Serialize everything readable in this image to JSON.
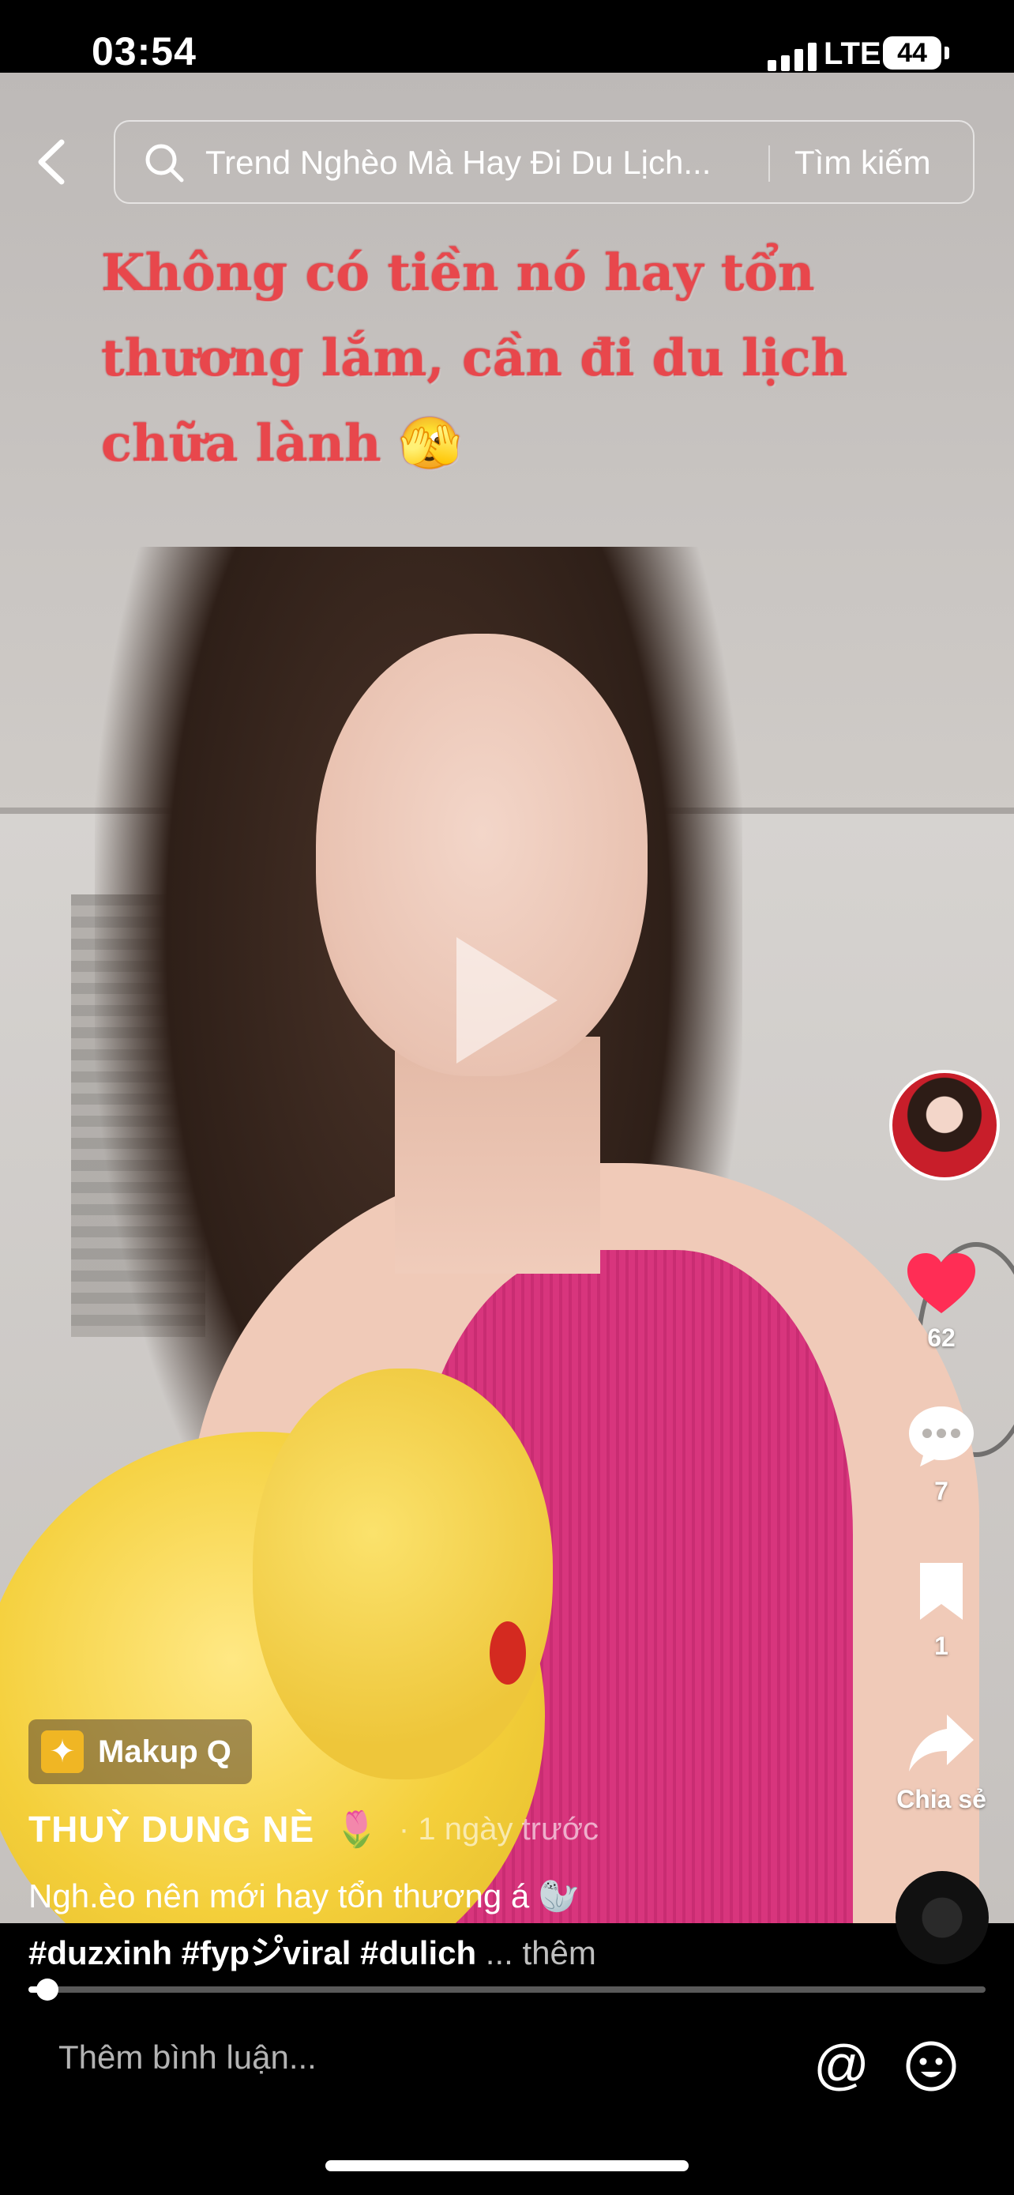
{
  "status_bar": {
    "time": "03:54",
    "network": "LTE",
    "battery": "44"
  },
  "search": {
    "query": "Trend Nghèo Mà Hay Đi Du Lịch...",
    "button_label": "Tìm kiếm"
  },
  "video": {
    "overlay_text": "Không có tiền nó hay tổn thương lắm, cần đi du lịch chữa lành 🫣"
  },
  "rail": {
    "likes": "62",
    "comments": "7",
    "bookmarks": "1",
    "share_label": "Chia sẻ"
  },
  "post": {
    "effect_label": "Makup Q",
    "author": "THUỲ DUNG NÈ",
    "author_emoji": "🌷",
    "posted": "· 1 ngày trước",
    "description": "Ngh.èo nên mới hay tổn thương á 🦭",
    "hashtags": "#duzxinh #fypシ゚viral #dulich",
    "more_label": "... thêm",
    "progress": 0.02
  },
  "comment": {
    "placeholder": "Thêm bình luận..."
  },
  "colors": {
    "like": "#ff2d55",
    "overlay_text": "#e8474c",
    "top": "#d8357d"
  }
}
